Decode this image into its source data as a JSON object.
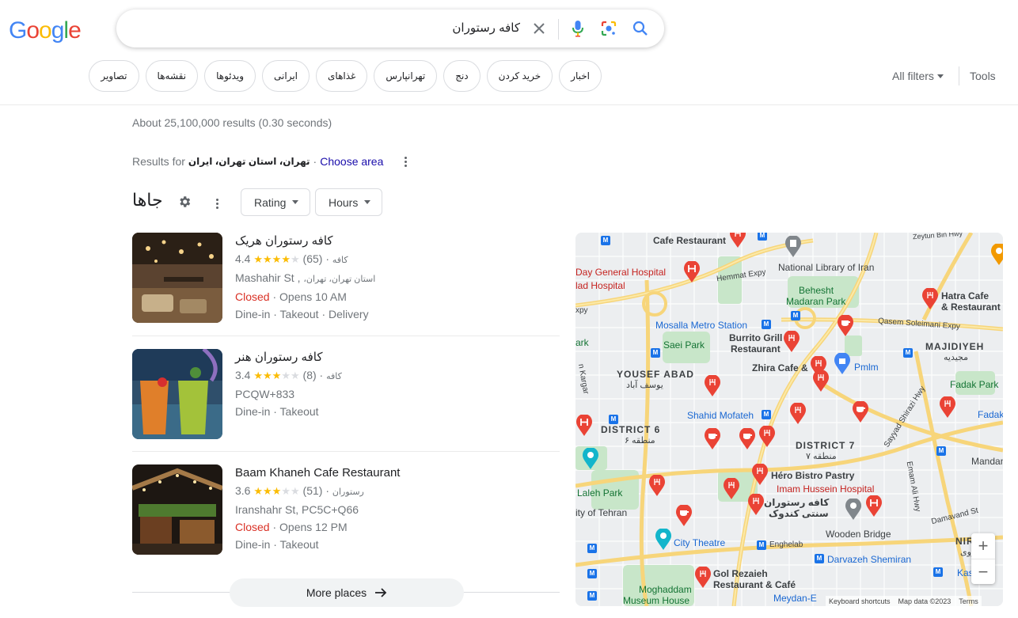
{
  "header": {
    "logo": [
      "G",
      "o",
      "o",
      "g",
      "l",
      "e"
    ],
    "logo_colors": [
      "#4285f4",
      "#ea4335",
      "#fbbc05",
      "#4285f4",
      "#34a853",
      "#ea4335"
    ],
    "search_query": "کافه رستوران",
    "icons": [
      "close-icon",
      "microphone-icon",
      "lens-icon",
      "search-icon"
    ]
  },
  "chips": [
    "اخبار",
    "خرید کردن",
    "دنج",
    "تهرانپارس",
    "غذاهای",
    "ایرانی",
    "ویدئوها",
    "نقشه‌ها",
    "تصاویر"
  ],
  "toolbar": {
    "all_filters": "All filters",
    "tools": "Tools"
  },
  "stats": "About 25,100,000 results (0.30 seconds)",
  "location": {
    "prefix": "Results for",
    "place": "تهران، استان تهران، ایران",
    "dot": "·",
    "choose_area": "Choose area"
  },
  "places": {
    "title": "جاها",
    "filters": [
      "Rating",
      "Hours"
    ],
    "items": [
      {
        "name": "کافه رستوران هریک",
        "rating": "4.4",
        "stars": 4.5,
        "reviews": "(65)",
        "category": "کافه",
        "address_en": "Mashahir St ,",
        "address_fa": "استان تهران، تهران،",
        "status": "Closed",
        "status_sep": "·",
        "opens": "Opens 10 AM",
        "services": "Dine-in · Takeout · Delivery"
      },
      {
        "name": "کافه رستوران هنر",
        "rating": "3.4",
        "stars": 3.5,
        "reviews": "(8)",
        "category": "کافه",
        "address_en": "PCQW+833",
        "address_fa": "",
        "status": "",
        "status_sep": "",
        "opens": "",
        "services": "Dine-in · Takeout"
      },
      {
        "name": "Baam Khaneh Cafe Restaurant",
        "rating": "3.6",
        "stars": 3.5,
        "reviews": "(51)",
        "category": "رستوران",
        "address_en": "Iranshahr St, PC5C+Q66",
        "address_fa": "",
        "status": "Closed",
        "status_sep": "·",
        "opens": "Opens 12 PM",
        "services": "Dine-in · Takeout"
      }
    ],
    "more_places": "More places"
  },
  "map": {
    "labels": [
      {
        "text": "Cafe Restaurant",
        "type": "dark"
      },
      {
        "text": "Day General Hospital",
        "type": "red"
      },
      {
        "text": "lad Hospital",
        "type": "red"
      },
      {
        "text": "Hemmat Expy",
        "type": "dark"
      },
      {
        "text": "National Library of Iran",
        "type": "dark"
      },
      {
        "text": "Behesht",
        "type": "green"
      },
      {
        "text": "Madaran Park",
        "type": "green"
      },
      {
        "text": "Hatra Cafe",
        "type": "dark"
      },
      {
        "text": "& Restaurant",
        "type": "dark"
      },
      {
        "text": "Qasem Soleimani Expy",
        "type": "dark"
      },
      {
        "text": "xpy",
        "type": "dark"
      },
      {
        "text": "Mosalla Metro Station",
        "type": "blue"
      },
      {
        "text": "Saei Park",
        "type": "green"
      },
      {
        "text": "Burrito Grill",
        "type": "dark"
      },
      {
        "text": "Restaurant",
        "type": "dark"
      },
      {
        "text": "MAJIDIYEH",
        "type": "district"
      },
      {
        "text": "مجیدیه",
        "type": "dark"
      },
      {
        "text": "ark",
        "type": "green"
      },
      {
        "text": "YOUSEF ABAD",
        "type": "district"
      },
      {
        "text": "یوسف آباد",
        "type": "dark"
      },
      {
        "text": "Zhira Cafe &",
        "type": "dark"
      },
      {
        "text": "Pmlm",
        "type": "blue"
      },
      {
        "text": "Fadak Park",
        "type": "green"
      },
      {
        "text": "Shahid Mofateh",
        "type": "blue"
      },
      {
        "text": "DISTRICT 6",
        "type": "district"
      },
      {
        "text": "منطقه ۶",
        "type": "dark"
      },
      {
        "text": "DISTRICT 7",
        "type": "district"
      },
      {
        "text": "منطقه ۷",
        "type": "dark"
      },
      {
        "text": "Fadak",
        "type": "blue"
      },
      {
        "text": "Sayyad Shirazi Hwy",
        "type": "dark"
      },
      {
        "text": "Mandan",
        "type": "dark"
      },
      {
        "text": "Héro Bistro Pastry",
        "type": "dark"
      },
      {
        "text": "Imam Hussein Hospital",
        "type": "red"
      },
      {
        "text": "Laleh Park",
        "type": "green"
      },
      {
        "text": "کافه رستوران",
        "type": "dark"
      },
      {
        "text": "سنتی کندوک",
        "type": "dark"
      },
      {
        "text": "ity of Tehran",
        "type": "dark"
      },
      {
        "text": "Damavand St",
        "type": "dark"
      },
      {
        "text": "Wooden Bridge",
        "type": "dark"
      },
      {
        "text": "City Theatre",
        "type": "blue"
      },
      {
        "text": "Enghelab",
        "type": "dark"
      },
      {
        "text": "NIROO",
        "type": "district"
      },
      {
        "text": "نیروی",
        "type": "dark"
      },
      {
        "text": "Darvazeh Shemiran",
        "type": "blue"
      },
      {
        "text": "Kasa",
        "type": "blue"
      },
      {
        "text": "Gol Rezaieh",
        "type": "dark"
      },
      {
        "text": "Restaurant & Café",
        "type": "dark"
      },
      {
        "text": "Moghaddam",
        "type": "green"
      },
      {
        "text": "Museum House",
        "type": "green"
      },
      {
        "text": "Meydan-E",
        "type": "blue"
      },
      {
        "text": "Zeytun Bin Hwy",
        "type": "dark"
      },
      {
        "text": "Emam Ali Hwy",
        "type": "dark"
      },
      {
        "text": "n Kargar",
        "type": "dark"
      }
    ],
    "zoom_in": "+",
    "zoom_out": "−",
    "keyboard_shortcuts": "Keyboard shortcuts",
    "map_data": "Map data ©2023",
    "terms": "Terms"
  }
}
